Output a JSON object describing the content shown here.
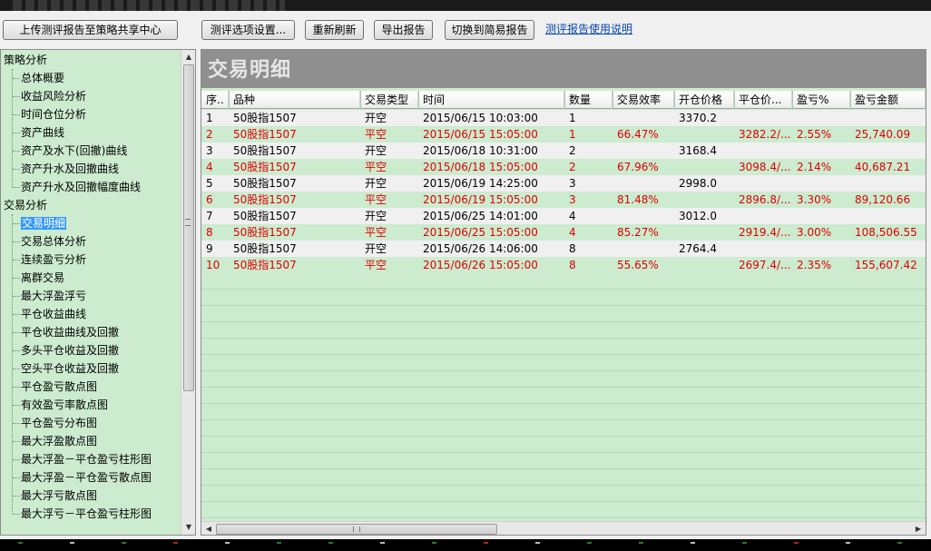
{
  "toolbar": {
    "upload_label": "上传测评报告至策略共享中心",
    "settings_label": "测评选项设置...",
    "refresh_label": "重新刷新",
    "export_label": "导出报告",
    "switch_label": "切换到简易报告",
    "help_link": "测评报告使用说明"
  },
  "tree": {
    "group1": "策略分析",
    "group1_items": [
      "总体概要",
      "收益风险分析",
      "时间仓位分析",
      "资产曲线",
      "资产及水下(回撤)曲线",
      "资产升水及回撤曲线",
      "资产升水及回撤幅度曲线"
    ],
    "group2": "交易分析",
    "group2_items": [
      "交易明细",
      "交易总体分析",
      "连续盈亏分析",
      "离群交易",
      "最大浮盈浮亏",
      "平仓收益曲线",
      "平仓收益曲线及回撤",
      "多头平仓收益及回撤",
      "空头平仓收益及回撤",
      "平仓盈亏散点图",
      "有效盈亏率散点图",
      "平仓盈亏分布图",
      "最大浮盈散点图",
      "最大浮盈－平仓盈亏柱形图",
      "最大浮盈－平仓盈亏散点图",
      "最大浮亏散点图",
      "最大浮亏－平仓盈亏柱形图"
    ],
    "selected": "交易明细"
  },
  "content": {
    "title": "交易明细"
  },
  "table": {
    "columns": [
      "序..",
      "品种",
      "交易类型",
      "时间",
      "数量",
      "交易效率",
      "开仓价格",
      "平仓价...",
      "盈亏%",
      "盈亏金额"
    ],
    "rows": [
      [
        "1",
        "50股指1507",
        "开空",
        "2015/06/15 10:03:00",
        "1",
        "",
        "3370.2",
        "",
        "",
        ""
      ],
      [
        "2",
        "50股指1507",
        "平空",
        "2015/06/15 15:05:00",
        "1",
        "66.47%",
        "",
        "3282.2/...",
        "2.55%",
        "25,740.09"
      ],
      [
        "3",
        "50股指1507",
        "开空",
        "2015/06/18 10:31:00",
        "2",
        "",
        "3168.4",
        "",
        "",
        ""
      ],
      [
        "4",
        "50股指1507",
        "平空",
        "2015/06/18 15:05:00",
        "2",
        "67.96%",
        "",
        "3098.4/...",
        "2.14%",
        "40,687.21"
      ],
      [
        "5",
        "50股指1507",
        "开空",
        "2015/06/19 14:25:00",
        "3",
        "",
        "2998.0",
        "",
        "",
        ""
      ],
      [
        "6",
        "50股指1507",
        "平空",
        "2015/06/19 15:05:00",
        "3",
        "81.48%",
        "",
        "2896.8/...",
        "3.30%",
        "89,120.66"
      ],
      [
        "7",
        "50股指1507",
        "开空",
        "2015/06/25 14:01:00",
        "4",
        "",
        "3012.0",
        "",
        "",
        ""
      ],
      [
        "8",
        "50股指1507",
        "平空",
        "2015/06/25 15:05:00",
        "4",
        "85.27%",
        "",
        "2919.4/...",
        "3.00%",
        "108,506.55"
      ],
      [
        "9",
        "50股指1507",
        "开空",
        "2015/06/26 14:06:00",
        "8",
        "",
        "2764.4",
        "",
        "",
        ""
      ],
      [
        "10",
        "50股指1507",
        "平空",
        "2015/06/26 15:05:00",
        "8",
        "55.65%",
        "",
        "2697.4/...",
        "2.35%",
        "155,607.42"
      ]
    ]
  },
  "colors": {
    "panel_bg": "#ccebcf",
    "banner_bg": "#8f8f8f",
    "profit_red": "#e00000",
    "selected_blue": "#3399ff"
  }
}
